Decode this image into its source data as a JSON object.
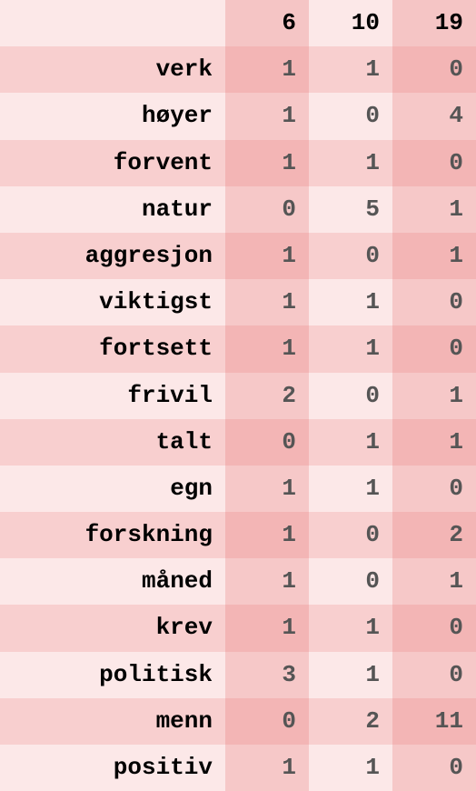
{
  "chart_data": {
    "type": "table",
    "title": "",
    "columns": [
      "6",
      "10",
      "19"
    ],
    "rows": [
      {
        "label": "verk",
        "values": [
          1,
          1,
          0
        ]
      },
      {
        "label": "høyer",
        "values": [
          1,
          0,
          4
        ]
      },
      {
        "label": "forvent",
        "values": [
          1,
          1,
          0
        ]
      },
      {
        "label": "natur",
        "values": [
          0,
          5,
          1
        ]
      },
      {
        "label": "aggresjon",
        "values": [
          1,
          0,
          1
        ]
      },
      {
        "label": "viktigst",
        "values": [
          1,
          1,
          0
        ]
      },
      {
        "label": "fortsett",
        "values": [
          1,
          1,
          0
        ]
      },
      {
        "label": "frivil",
        "values": [
          2,
          0,
          1
        ]
      },
      {
        "label": "talt",
        "values": [
          0,
          1,
          1
        ]
      },
      {
        "label": "egn",
        "values": [
          1,
          1,
          0
        ]
      },
      {
        "label": "forskning",
        "values": [
          1,
          0,
          2
        ]
      },
      {
        "label": "måned",
        "values": [
          1,
          0,
          1
        ]
      },
      {
        "label": "krev",
        "values": [
          1,
          1,
          0
        ]
      },
      {
        "label": "politisk",
        "values": [
          3,
          1,
          0
        ]
      },
      {
        "label": "menn",
        "values": [
          0,
          2,
          11
        ]
      },
      {
        "label": "positiv",
        "values": [
          1,
          1,
          0
        ]
      }
    ]
  }
}
